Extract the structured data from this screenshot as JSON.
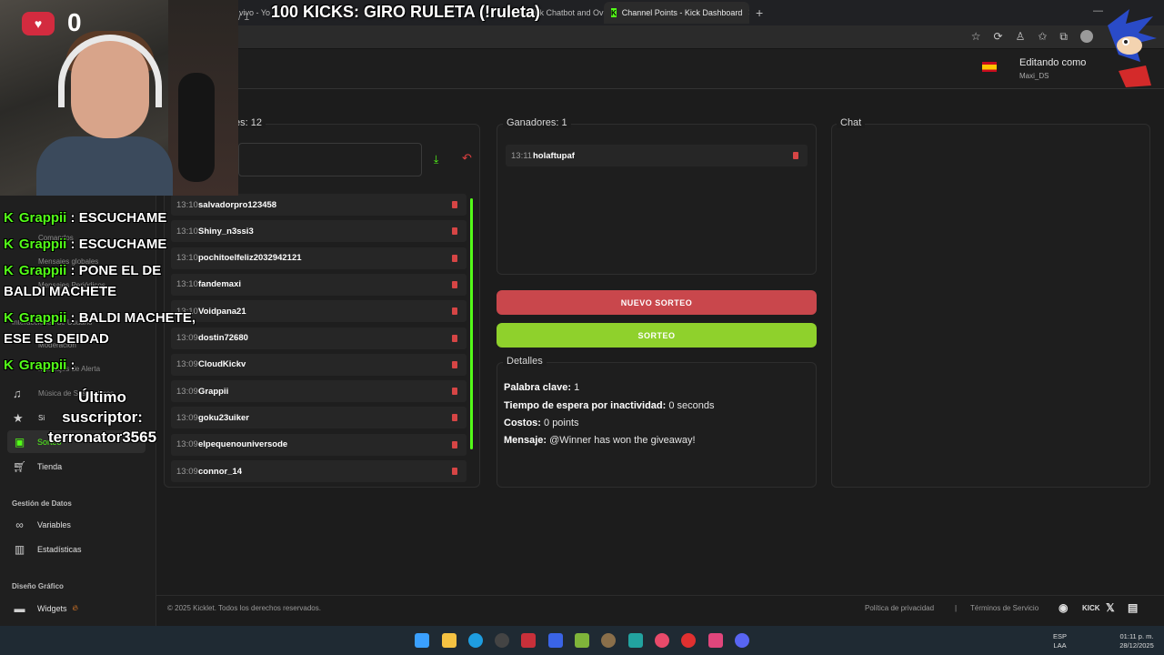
{
  "browser": {
    "tabs": [
      {
        "label": "vivo - You",
        "active": false
      },
      {
        "label": "pp - Kick Chatbot and Ov",
        "active": false
      },
      {
        "label": "Channel Points - Kick Dashboard",
        "active": true
      }
    ],
    "close_glyph": "✕",
    "newtab_glyph": "+"
  },
  "header": {
    "breadcrumb": "/ 1",
    "editing_label": "Editando como",
    "editing_user": "Maxi_DS"
  },
  "sidebar": {
    "faded_items": [
      "Comandos",
      "Mensajes globales",
      "Mensajes Periódicos",
      "Interacciones de Usuario",
      "Moderación",
      "Mensajes de Alerta",
      "Música de Suscriptores"
    ],
    "items": [
      {
        "label": "Sorteo",
        "icon": "gift-icon",
        "active": true
      },
      {
        "label": "Tienda",
        "icon": "cart-icon",
        "active": false
      }
    ],
    "section_data": "Gestión de Datos",
    "data_items": [
      {
        "label": "Variables",
        "icon": "link-icon"
      },
      {
        "label": "Estadísticas",
        "icon": "bar-chart-icon"
      }
    ],
    "section_design": "Diseño Gráfico",
    "design_items": [
      {
        "label": "Widgets",
        "icon": "widgets-icon"
      }
    ],
    "partial_label": "Si"
  },
  "participants": {
    "title": "es: 12",
    "rows": [
      {
        "time": "13:10",
        "user": "salvadorpro123458"
      },
      {
        "time": "13:10",
        "user": "Shiny_n3ssi3"
      },
      {
        "time": "13:10",
        "user": "pochitoelfeliz2032942121"
      },
      {
        "time": "13:10",
        "user": "fandemaxi"
      },
      {
        "time": "13:10",
        "user": "Voidpana21"
      },
      {
        "time": "13:09",
        "user": "dostin72680"
      },
      {
        "time": "13:09",
        "user": "CloudKickv"
      },
      {
        "time": "13:09",
        "user": "Grappii"
      },
      {
        "time": "13:09",
        "user": "goku23uiker"
      },
      {
        "time": "13:09",
        "user": "elpequenouniversode"
      },
      {
        "time": "13:09",
        "user": "connor_14"
      }
    ]
  },
  "winners": {
    "title": "Ganadores: 1",
    "rows": [
      {
        "time": "13:11",
        "user": "holaftupaf"
      }
    ]
  },
  "actions": {
    "new_raffle": "NUEVO SORTEO",
    "raffle": "SORTEO"
  },
  "details": {
    "title": "Detalles",
    "keyword_label": "Palabra clave:",
    "keyword_value": "1",
    "wait_label": "Tiempo de espera por inactividad:",
    "wait_value": "0 seconds",
    "cost_label": "Costos:",
    "cost_value": "0 points",
    "message_label": "Mensaje:",
    "message_value": "@Winner has won the giveaway!"
  },
  "chat": {
    "title": "Chat"
  },
  "footer": {
    "copyright": "© 2025 Kicklet. Todos los derechos reservados.",
    "privacy": "Política de privacidad",
    "separator": "|",
    "terms": "Términos de Servicio",
    "kick_text": "KICK"
  },
  "taskbar": {
    "lang": "ESP",
    "lang_sub": "LAA",
    "time": "01:11 p. m.",
    "date": "28/12/2025"
  },
  "overlay": {
    "stream_title": "100 KICKS: GIRO RULETA (!ruleta)",
    "heart_count": "0",
    "chat": [
      {
        "name": "Grappii",
        "text": ": ESCUCHAME"
      },
      {
        "name": "Grappii",
        "text": ": ESCUCHAME"
      },
      {
        "name": "Grappii",
        "text": ": PONE EL DE BALDI MACHETE"
      },
      {
        "name": "Grappii",
        "text": ": BALDI MACHETE, ESE ES DEIDAD"
      },
      {
        "name": "Grappii",
        "text": ":"
      }
    ],
    "sub_label": "Último suscriptor:",
    "sub_user": "terronator3565"
  },
  "colors": {
    "accent_green": "#53fc18",
    "raffle_green": "#8fd12c",
    "danger_red": "#c9474c",
    "background": "#1c1c1c"
  }
}
